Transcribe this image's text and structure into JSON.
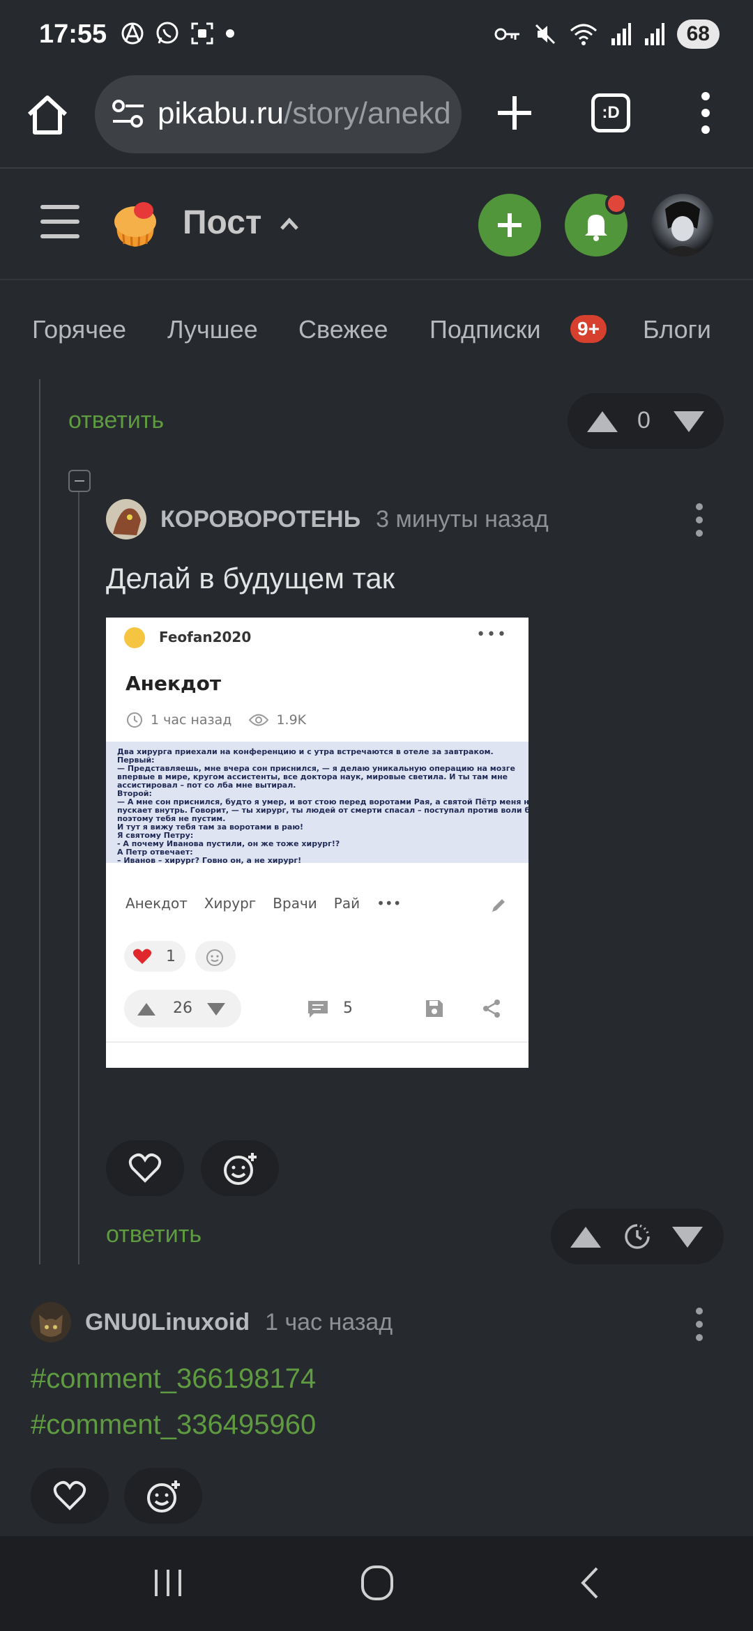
{
  "status_bar": {
    "time": "17:55",
    "battery": "68",
    "icons": [
      "anarchy-icon",
      "whatsapp-icon",
      "screenshot-icon",
      "dot-icon",
      "key-icon",
      "mute-icon",
      "wifi-icon",
      "signal-icon",
      "signal-icon"
    ]
  },
  "browser": {
    "url_domain": "pikabu.ru",
    "url_path": "/story/anekd",
    "tabs_label": ":D"
  },
  "header": {
    "title": "Пост"
  },
  "nav": {
    "tabs": [
      "Горячее",
      "Лучшее",
      "Свежее",
      "Подписки",
      "Блоги"
    ],
    "subscriptions_badge": "9+"
  },
  "comments": {
    "reply_label": "ответить",
    "first_vote_count": "0",
    "reply": {
      "author": "КОРОВОРОТЕНЬ",
      "time": "3 минуты назад",
      "text": "Делай в будущем так",
      "screenshot": {
        "author": "Feofan2020",
        "title": "Анекдот",
        "time": "1 час назад",
        "views": "1.9K",
        "lines": [
          "Два хирурга приехали на конференцию и с утра встречаются в отеле за завтраком.",
          "Первый:",
          "— Представляешь, мне вчера сон приснился, — я делаю уникальную операцию на мозге",
          "впервые в мире, кругом ассистенты, все доктора наук, мировые светила. И ты там мне",
          "ассистировал – пот со лба мне вытирал.",
          "Второй:",
          "— А мне сон приснился, будто я умер, и вот стою перед воротами Рая, а святой Пётр меня не",
          "пускает внутрь. Говорит, — ты хирург, ты людей от смерти спасал – поступал против воли бога,",
          "поэтому тебя не пустим.",
          "И тут я вижу тебя там за воротами в раю!",
          "Я святому Петру:",
          "- А почему Иванова пустили, он же тоже хирург!?",
          "А Петр отвечает:",
          "– Иванов – хирург? Говно он, а не хирург!"
        ],
        "tags": [
          "Анекдот",
          "Хирург",
          "Врачи",
          "Рай",
          "•••"
        ],
        "likes": "1",
        "rating": "26",
        "comments_count": "5"
      }
    },
    "second": {
      "author": "GNU0Linuxoid",
      "time": "1 час назад",
      "links": [
        "#comment_366198174",
        "#comment_336495960"
      ]
    }
  },
  "colors": {
    "background": "#26292d",
    "accent_green": "#52963c",
    "link_green": "#5f9b41",
    "badge_red": "#d7402f"
  }
}
